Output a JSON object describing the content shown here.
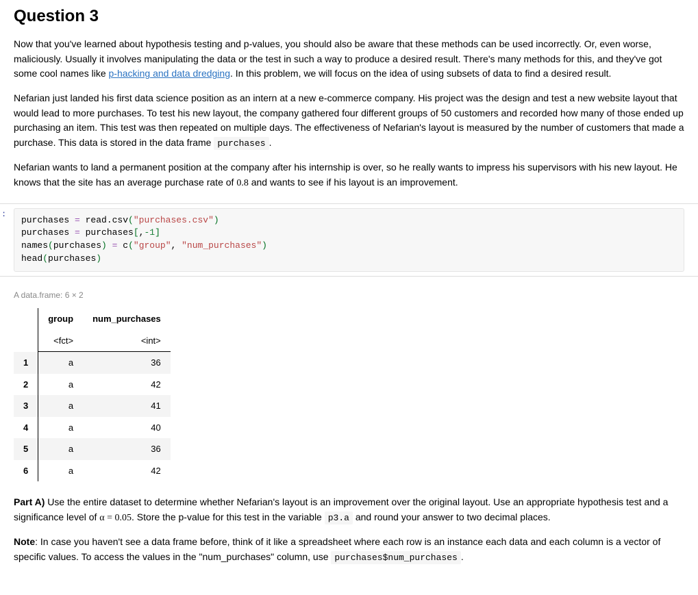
{
  "heading": "Question 3",
  "para1_a": "Now that you've learned about hypothesis testing and p-values, you should also be aware that these methods can be used incorrectly. Or, even worse, maliciously. Usually it involves manipulating the data or the test in such a way to produce a desired result. There's many methods for this, and they've got some cool names like ",
  "link1": "p-hacking and data dredging",
  "para1_b": ". In this problem, we will focus on the idea of using subsets of data to find a desired result.",
  "para2_a": "Nefarian just landed his first data science position as an intern at a new e-commerce company. His project was the design and test a new website layout that would lead to more purchases. To test his new layout, the company gathered four different groups of 50 customers and recorded how many of those ended up purchasing an item. This test was then repeated on multiple days. The effectiveness of Nefarian's layout is measured by the number of customers that made a purchase. This data is stored in the data frame ",
  "code_purchases": "purchases",
  "para2_b": ".",
  "para3_a": "Nefarian wants to land a permanent position at the company after his internship is over, so he really wants to impress his supervisors with his new layout. He knows that the site has an average purchase rate of ",
  "math_08": "0.8",
  "para3_b": " and wants to see if his layout is an improvement.",
  "in_prompt": ":",
  "code_block": {
    "l1_a": "purchases ",
    "l1_eq": "=",
    "l1_b": " read.csv",
    "l1_p1": "(",
    "l1_str": "\"purchases.csv\"",
    "l1_p2": ")",
    "l2_a": "purchases ",
    "l2_eq": "=",
    "l2_b": " purchases",
    "l2_p1": "[",
    "l2_c": ",",
    "l2_neg1": "-1",
    "l2_p2": "]",
    "l3_a": "names",
    "l3_p1": "(",
    "l3_b": "purchases",
    "l3_p2": ")",
    "l3_sp": " ",
    "l3_eq": "=",
    "l3_sp2": " c",
    "l3_p3": "(",
    "l3_str1": "\"group\"",
    "l3_comma": ", ",
    "l3_str2": "\"num_purchases\"",
    "l3_p4": ")",
    "l4_a": "head",
    "l4_p1": "(",
    "l4_b": "purchases",
    "l4_p2": ")"
  },
  "output_caption": "A data.frame: 6 × 2",
  "table": {
    "blank": "",
    "col1": "group",
    "col2": "num_purchases",
    "type1": "<fct>",
    "type2": "<int>",
    "rows": [
      {
        "idx": "1",
        "group": "a",
        "num": "36"
      },
      {
        "idx": "2",
        "group": "a",
        "num": "42"
      },
      {
        "idx": "3",
        "group": "a",
        "num": "41"
      },
      {
        "idx": "4",
        "group": "a",
        "num": "40"
      },
      {
        "idx": "5",
        "group": "a",
        "num": "36"
      },
      {
        "idx": "6",
        "group": "a",
        "num": "42"
      }
    ]
  },
  "partA_label": "Part A)",
  "partA_a": " Use the entire dataset to determine whether Nefarian's layout is an improvement over the original layout. Use an appropriate hypothesis test and a significance level of ",
  "alpha_eq": "α = 0.05",
  "partA_b": ". Store the p-value for this test in the variable ",
  "code_p3a": "p3.a",
  "partA_c": " and round your answer to two decimal places.",
  "note_label": "Note",
  "note_a": ": In case you haven't see a data frame before, think of it like a spreadsheet where each row is an instance each data and each column is a vector of specific values. To access the values in the \"num_purchases\" column, use ",
  "code_access": "purchases$num_purchases",
  "note_b": "."
}
